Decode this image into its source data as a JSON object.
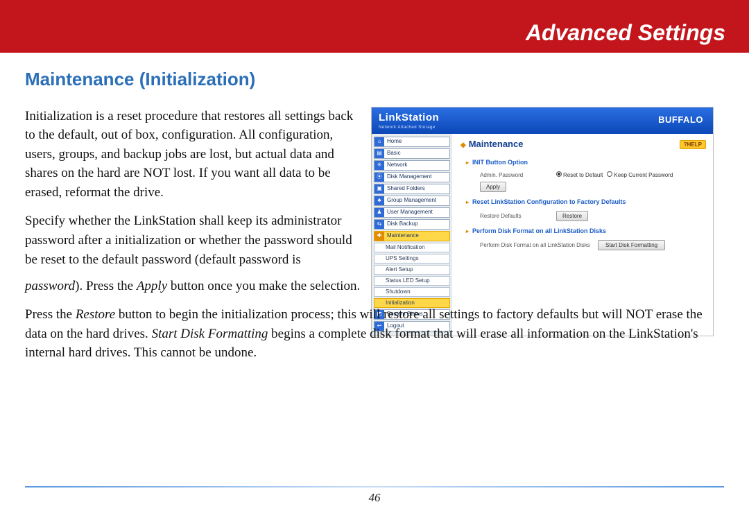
{
  "header": {
    "title": "Advanced Settings"
  },
  "section": {
    "title": "Maintenance (Initialization)"
  },
  "paragraphs": {
    "p1": "Initialization is a reset procedure that restores all settings back to the default, out of box, configuration.  All configuration, users, groups, and backup jobs are lost, but actual data and shares on the hard are NOT lost.  If you want all data to be erased, reformat the drive.",
    "p2a": "Specify whether the LinkStation shall keep its administrator password after a initialization or whether the password should be reset to the default password (default password is ",
    "p2_i1": "password",
    "p2b": ").   Press the ",
    "p2_i2": "Apply",
    "p2c": " button once you make the selection.",
    "p3a": "Press the ",
    "p3_i1": "Restore",
    "p3b": " button to begin the initialization process; this will restore all settings to factory defaults but will NOT erase the data on the hard drives.  ",
    "p3_i2": "Start Disk Formatting",
    "p3c": " begins a complete disk format that will erase all information on the LinkStation's internal hard drives.  This cannot be undone."
  },
  "screenshot": {
    "brand": "LinkStation",
    "brand_sub": "Network Attached Storage",
    "maker": "BUFFALO",
    "nav": {
      "home": "Home",
      "basic": "Basic",
      "network": "Network",
      "disk": "Disk Management",
      "shared": "Shared Folders",
      "group": "Group Management",
      "user": "User Management",
      "backup": "Disk Backup",
      "maint": "Maintenance",
      "mail": "Mail Notification",
      "ups": "UPS Settings",
      "alert": "Alert Setup",
      "led": "Status LED Setup",
      "shutdown": "Shutdown",
      "init": "Initialization",
      "status": "System Status",
      "logout": "Logout"
    },
    "main": {
      "title": "Maintenance",
      "help": "?HELP",
      "sec1": "INIT Button Option",
      "s1_label": "Admin. Password",
      "s1_opt1": "Reset to Default",
      "s1_opt2": "Keep Current Password",
      "apply": "Apply",
      "sec2": "Reset LinkStation Configuration to Factory Defaults",
      "s2_label": "Restore Defaults",
      "restore": "Restore",
      "sec3": "Perform Disk Format on all LinkStation Disks",
      "s3_label": "Perform Disk Format on all LinkStation Disks",
      "start_fmt": "Start Disk Formatting"
    }
  },
  "page_number": "46"
}
